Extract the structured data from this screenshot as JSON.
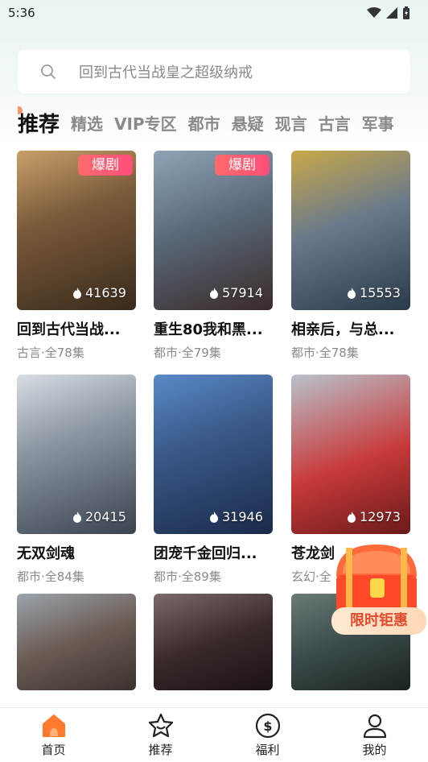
{
  "status_bar": {
    "time": "5:36"
  },
  "search": {
    "placeholder": "回到古代当战皇之超级纳戒"
  },
  "tabs": [
    {
      "label": "推荐",
      "active": true
    },
    {
      "label": "精选"
    },
    {
      "label": "VIP专区"
    },
    {
      "label": "都市"
    },
    {
      "label": "悬疑"
    },
    {
      "label": "现言"
    },
    {
      "label": "古言"
    },
    {
      "label": "军事"
    }
  ],
  "cards": [
    {
      "title": "回到古代当战...",
      "meta": "古言·全78集",
      "views": "41639",
      "badge": "爆剧"
    },
    {
      "title": "重生80我和黑...",
      "meta": "都市·全79集",
      "views": "57914",
      "badge": "爆剧"
    },
    {
      "title": "相亲后，与总...",
      "meta": "都市·全78集",
      "views": "15553"
    },
    {
      "title": "无双剑魂",
      "meta": "都市·全84集",
      "views": "20415"
    },
    {
      "title": "团宠千金回归...",
      "meta": "都市·全89集",
      "views": "31946"
    },
    {
      "title": "苍龙剑",
      "meta": "玄幻·全",
      "views": "12973"
    }
  ],
  "promo": {
    "label": "限时钜惠"
  },
  "bottom_nav": [
    {
      "label": "首页",
      "icon": "home-icon",
      "active": true
    },
    {
      "label": "推荐",
      "icon": "star-icon"
    },
    {
      "label": "福利",
      "icon": "coin-icon"
    },
    {
      "label": "我的",
      "icon": "user-icon"
    }
  ],
  "colors": {
    "accent": "#ff7a2f",
    "badge": "#ff5a72",
    "promo": "#e04a2a"
  }
}
